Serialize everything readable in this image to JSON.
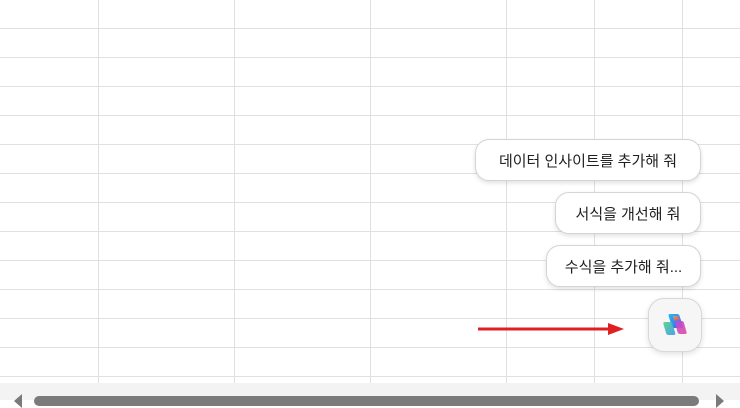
{
  "suggestions": [
    {
      "label": "데이터 인사이트를 추가해 줘"
    },
    {
      "label": "서식을 개선해 줘"
    },
    {
      "label": "수식을 추가해 줘..."
    }
  ],
  "copilot": {
    "icon": "copilot-icon"
  },
  "annotation": {
    "arrow_color": "#e02020",
    "icon": "red-arrow-icon"
  },
  "colors": {
    "gridline": "#e0e0e0",
    "bubble_border": "#d4d4d4",
    "scroll_thumb": "#7b7b7b"
  }
}
